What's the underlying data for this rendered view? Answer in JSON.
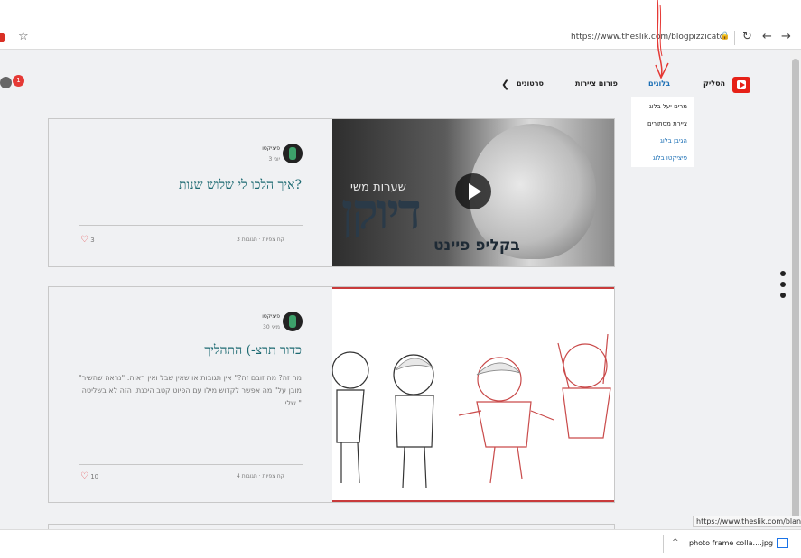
{
  "browser": {
    "url": "https://www.theslik.com/blogpizzicato",
    "status_url": "https://www.theslik.com/blank-1",
    "download_file": "photo frame colla....jpg"
  },
  "site": {
    "nav": {
      "home": "הסליק",
      "blogs": "בלוגים",
      "forum": "פורום ציירות",
      "videos": "סרטונים"
    },
    "badge_count": "1",
    "dropdown": [
      "מרים יעל בלוג",
      "ציירת מסתורים",
      "הגיבן בלוג",
      "פיציקטו בלוג"
    ]
  },
  "posts": [
    {
      "author": "פיציקטו",
      "meta": "יוני 3",
      "title": "איך הלכו לי שלוש שנות?",
      "excerpt": "",
      "stats": "קח צפיות · תגובות 3",
      "likes": "3"
    },
    {
      "author": "פיציקטו",
      "meta": "מאי 30",
      "title": "כדור תרצ-) התהליך",
      "excerpt": "\"מה זה? מה זובם זה?\" אין תגובות או שאין שבל ואין ראוה: \"נראה שהשיר מובן על\" מה אפשר לקדוש מילו עם הפיוט קטב היכנת, הזה לא בשליטה שלי.\"",
      "stats": "קח צפיות · תגובות 4",
      "likes": "10"
    }
  ],
  "media": {
    "post1_image_title": "דיוקן",
    "post1_image_sub": "שערות משי",
    "post1_image_sub2": "בקליפ פיינט"
  },
  "icons": [
    "stop-icon",
    "star-icon",
    "lock-icon",
    "reload-icon",
    "back-icon",
    "forward-icon",
    "youtube-icon",
    "chevron-left-icon",
    "heart-icon",
    "play-icon",
    "download-icon"
  ]
}
